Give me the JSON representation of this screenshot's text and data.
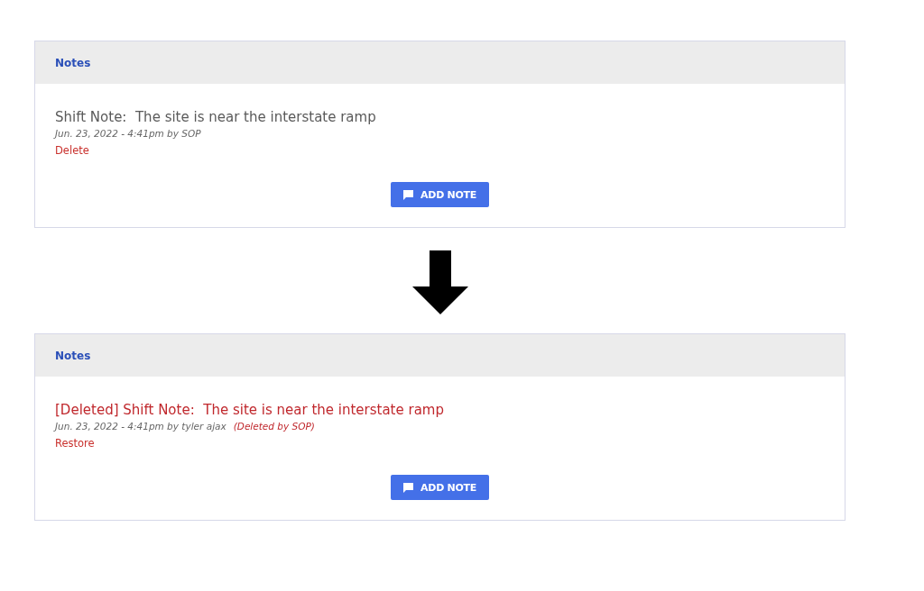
{
  "panels": [
    {
      "title": "Notes",
      "note": {
        "deleted": false,
        "title": "Shift Note:  The site is near the interstate ramp",
        "meta": "Jun. 23, 2022 - 4:41pm by SOP",
        "action": "Delete"
      },
      "button": "ADD NOTE"
    },
    {
      "title": "Notes",
      "note": {
        "deleted": true,
        "title": "[Deleted] Shift Note:  The site is near the interstate ramp",
        "meta": "Jun. 23, 2022 - 4:41pm by tyler ajax",
        "deleted_by": "(Deleted by SOP)",
        "action": "Restore"
      },
      "button": "ADD NOTE"
    }
  ]
}
